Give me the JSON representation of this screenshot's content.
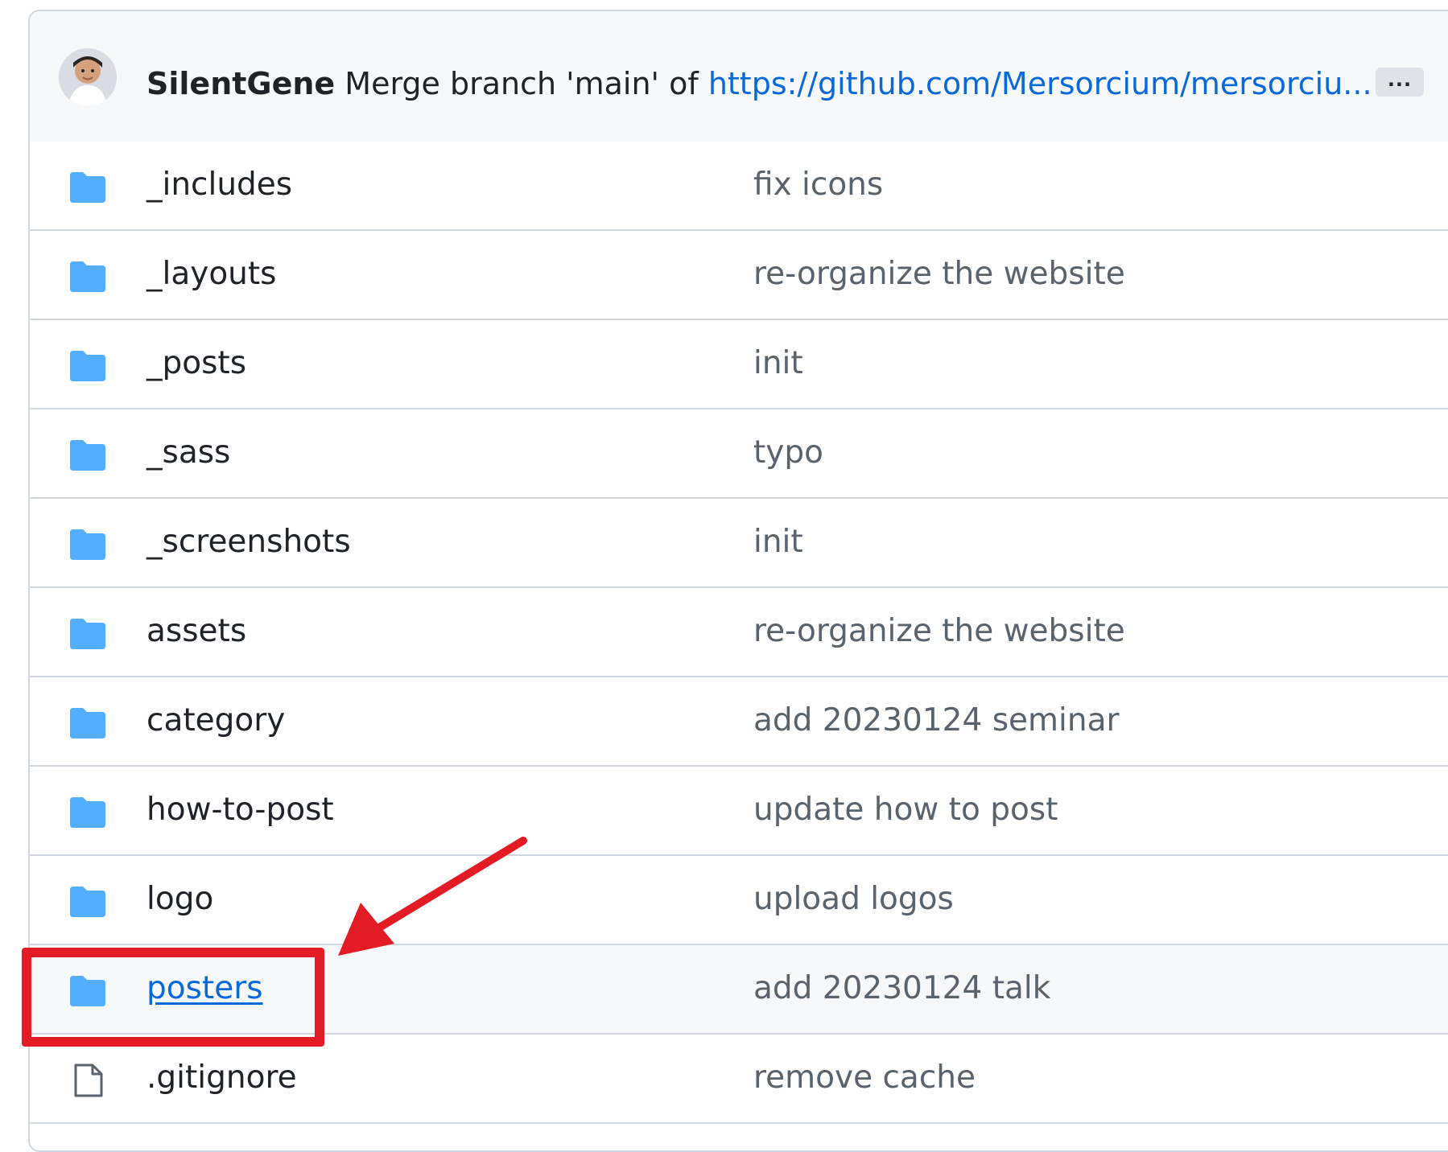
{
  "commit_header": {
    "author": "SilentGene",
    "message": "Merge branch 'main' of",
    "url": "https://github.com/Mersorcium/mersorciu...",
    "more_label": "..."
  },
  "files": [
    {
      "name": "_includes",
      "type": "folder",
      "message": "fix icons"
    },
    {
      "name": "_layouts",
      "type": "folder",
      "message": "re-organize the website"
    },
    {
      "name": "_posts",
      "type": "folder",
      "message": "init"
    },
    {
      "name": "_sass",
      "type": "folder",
      "message": "typo"
    },
    {
      "name": "_screenshots",
      "type": "folder",
      "message": "init"
    },
    {
      "name": "assets",
      "type": "folder",
      "message": "re-organize the website"
    },
    {
      "name": "category",
      "type": "folder",
      "message": "add 20230124 seminar"
    },
    {
      "name": "how-to-post",
      "type": "folder",
      "message": "update how to post"
    },
    {
      "name": "logo",
      "type": "folder",
      "message": "upload logos"
    },
    {
      "name": "posters",
      "type": "folder",
      "message": "add 20230124 talk"
    },
    {
      "name": ".gitignore",
      "type": "file",
      "message": "remove cache"
    }
  ],
  "colors": {
    "folder_icon": "#54aeff",
    "link": "#0969da",
    "annotation": "#e21b25",
    "header_bg": "#f6f8fa",
    "border": "#d0d7de"
  },
  "icons": {
    "folder": "folder-icon",
    "file": "file-icon",
    "more": "ellipsis-icon"
  }
}
